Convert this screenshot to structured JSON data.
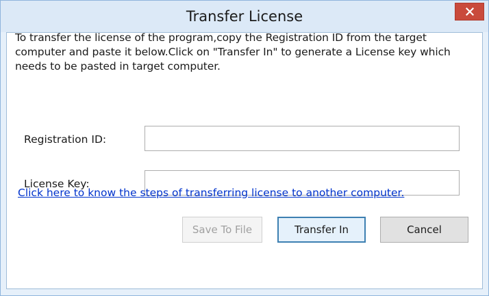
{
  "window": {
    "title": "Transfer License"
  },
  "dialog": {
    "description": "To transfer the license of the program,copy the Registration ID from the target computer and paste it below.Click on \"Transfer In\" to generate a License key which needs to be pasted in target computer.",
    "registration_label": "Registration ID:",
    "registration_value": "",
    "license_label": "License Key:",
    "license_value": "",
    "help_link": "Click here to know the steps of transferring license to another computer."
  },
  "buttons": {
    "save_label": "Save To File",
    "transfer_label": "Transfer In",
    "cancel_label": "Cancel"
  },
  "colors": {
    "close_button": "#c94a3c",
    "link": "#0033cc",
    "titlebar": "#dce9f7"
  },
  "icons": {
    "close": "close-icon"
  }
}
